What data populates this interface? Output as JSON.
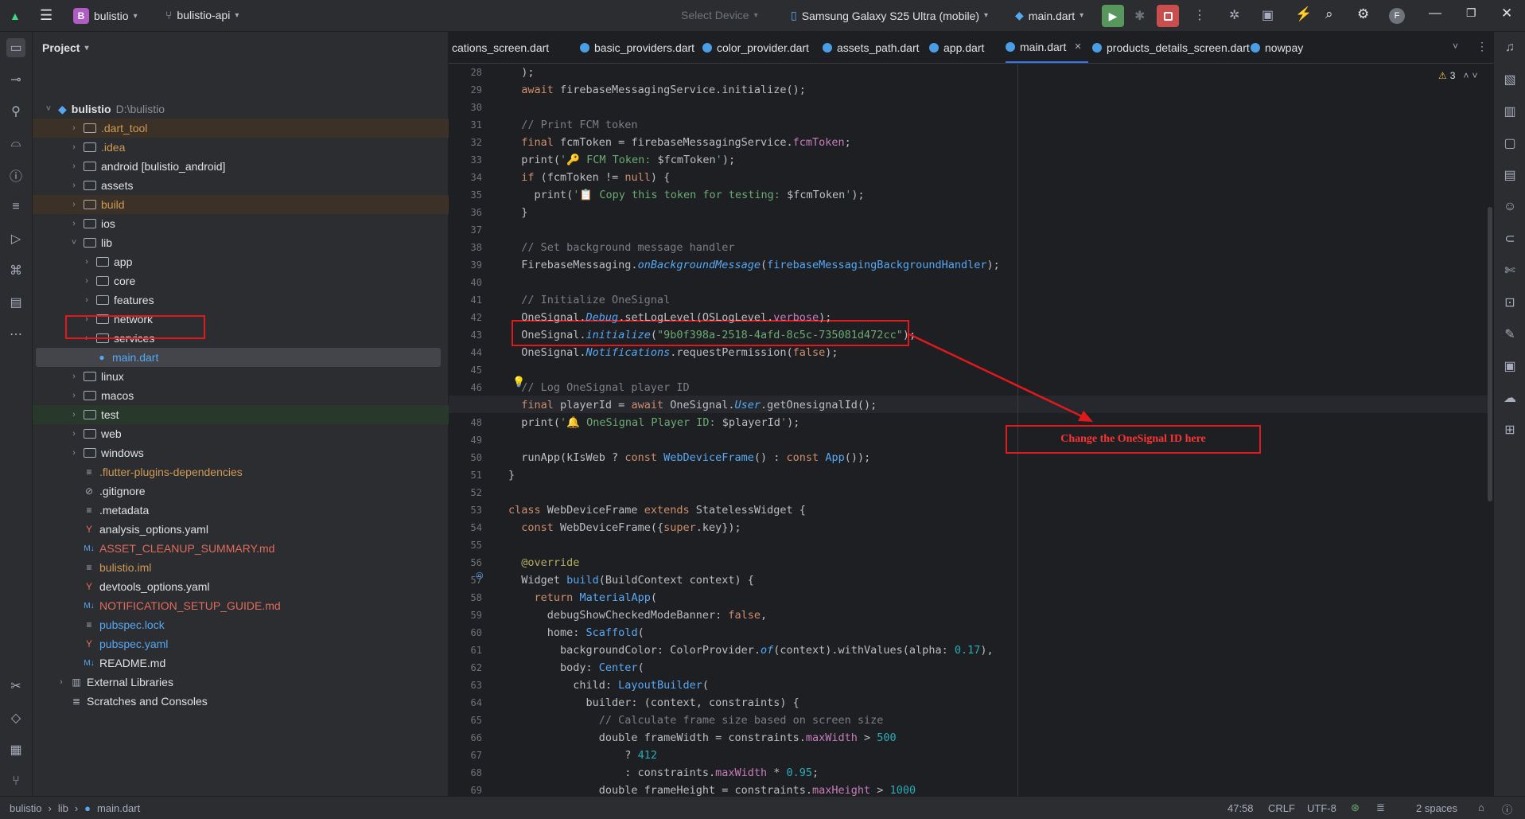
{
  "titlebar": {
    "project_badge": "B",
    "project_name": "bulistio",
    "branch": "bulistio-api",
    "select_device": "Select Device",
    "device": "Samsung Galaxy S25 Ultra (mobile)",
    "run_config": "main.dart",
    "avatar": "F"
  },
  "project_panel": {
    "title": "Project",
    "root_name": "bulistio",
    "root_path": "D:\\bulistio",
    "items": [
      {
        "label": ".dart_tool",
        "color": "#d09a55"
      },
      {
        "label": ".idea",
        "color": "#d09a55"
      },
      {
        "label": "android [bulistio_android]",
        "color": "#dfe1e5"
      },
      {
        "label": "assets",
        "color": "#dfe1e5"
      },
      {
        "label": "build",
        "color": "#d09a55"
      },
      {
        "label": "ios",
        "color": "#dfe1e5"
      },
      {
        "label": "lib",
        "color": "#dfe1e5"
      },
      {
        "label": "app",
        "color": "#dfe1e5"
      },
      {
        "label": "core",
        "color": "#dfe1e5"
      },
      {
        "label": "features",
        "color": "#dfe1e5"
      },
      {
        "label": "network",
        "color": "#dfe1e5"
      },
      {
        "label": "services",
        "color": "#dfe1e5"
      },
      {
        "label": "main.dart",
        "color": "#56a8f5"
      },
      {
        "label": "linux",
        "color": "#dfe1e5"
      },
      {
        "label": "macos",
        "color": "#dfe1e5"
      },
      {
        "label": "test",
        "color": "#dfe1e5"
      },
      {
        "label": "web",
        "color": "#dfe1e5"
      },
      {
        "label": "windows",
        "color": "#dfe1e5"
      },
      {
        "label": ".flutter-plugins-dependencies",
        "color": "#d09a55"
      },
      {
        "label": ".gitignore",
        "color": "#dfe1e5"
      },
      {
        "label": ".metadata",
        "color": "#dfe1e5"
      },
      {
        "label": "analysis_options.yaml",
        "color": "#dfe1e5"
      },
      {
        "label": "ASSET_CLEANUP_SUMMARY.md",
        "color": "#e06c5c"
      },
      {
        "label": "bulistio.iml",
        "color": "#d09a55"
      },
      {
        "label": "devtools_options.yaml",
        "color": "#dfe1e5"
      },
      {
        "label": "NOTIFICATION_SETUP_GUIDE.md",
        "color": "#e06c5c"
      },
      {
        "label": "pubspec.lock",
        "color": "#56a8f5"
      },
      {
        "label": "pubspec.yaml",
        "color": "#56a8f5"
      },
      {
        "label": "README.md",
        "color": "#dfe1e5"
      },
      {
        "label": "External Libraries",
        "color": "#dfe1e5"
      },
      {
        "label": "Scratches and Consoles",
        "color": "#dfe1e5"
      }
    ]
  },
  "tabs": [
    {
      "label": "cations_screen.dart"
    },
    {
      "label": "basic_providers.dart"
    },
    {
      "label": "color_provider.dart"
    },
    {
      "label": "assets_path.dart"
    },
    {
      "label": "app.dart"
    },
    {
      "label": "main.dart"
    },
    {
      "label": "products_details_screen.dart"
    },
    {
      "label": "nowpay"
    }
  ],
  "warnings": "3",
  "line_numbers": [
    "28",
    "29",
    "30",
    "31",
    "32",
    "33",
    "34",
    "35",
    "36",
    "37",
    "38",
    "39",
    "40",
    "41",
    "42",
    "43",
    "44",
    "45",
    "46",
    "47",
    "48",
    "49",
    "50",
    "51",
    "52",
    "53",
    "54",
    "55",
    "56",
    "57",
    "58",
    "59",
    "60",
    "61",
    "62",
    "63",
    "64",
    "65",
    "66",
    "67",
    "68",
    "69"
  ],
  "code": [
    [
      {
        "t": "  );",
        "c": ""
      }
    ],
    [
      {
        "t": "  ",
        "c": ""
      },
      {
        "t": "await",
        "c": "kw"
      },
      {
        "t": " firebaseMessagingService.initialize();",
        "c": ""
      }
    ],
    [],
    [
      {
        "t": "  // Print FCM token",
        "c": "cm"
      }
    ],
    [
      {
        "t": "  ",
        "c": ""
      },
      {
        "t": "final",
        "c": "kw"
      },
      {
        "t": " fcmToken = firebaseMessagingService.",
        "c": ""
      },
      {
        "t": "fcmToken",
        "c": "fld"
      },
      {
        "t": ";",
        "c": ""
      }
    ],
    [
      {
        "t": "  print(",
        "c": ""
      },
      {
        "t": "'🔑 FCM Token: ",
        "c": "str"
      },
      {
        "t": "$fcmToken",
        "c": ""
      },
      {
        "t": "'",
        "c": "str"
      },
      {
        "t": ");",
        "c": ""
      }
    ],
    [
      {
        "t": "  ",
        "c": ""
      },
      {
        "t": "if",
        "c": "kw"
      },
      {
        "t": " (fcmToken != ",
        "c": ""
      },
      {
        "t": "null",
        "c": "kw"
      },
      {
        "t": ") {",
        "c": ""
      }
    ],
    [
      {
        "t": "    print(",
        "c": ""
      },
      {
        "t": "'📋 Copy this token for testing: ",
        "c": "str"
      },
      {
        "t": "$fcmToken",
        "c": ""
      },
      {
        "t": "'",
        "c": "str"
      },
      {
        "t": ");",
        "c": ""
      }
    ],
    [
      {
        "t": "  }",
        "c": ""
      }
    ],
    [],
    [
      {
        "t": "  // Set background message handler",
        "c": "cm"
      }
    ],
    [
      {
        "t": "  FirebaseMessaging.",
        "c": ""
      },
      {
        "t": "onBackgroundMessage",
        "c": "it"
      },
      {
        "t": "(",
        "c": ""
      },
      {
        "t": "firebaseMessagingBackgroundHandler",
        "c": "fn"
      },
      {
        "t": ");",
        "c": ""
      }
    ],
    [],
    [
      {
        "t": "  // Initialize OneSignal",
        "c": "cm"
      }
    ],
    [
      {
        "t": "  OneSignal.",
        "c": ""
      },
      {
        "t": "Debug",
        "c": "it"
      },
      {
        "t": ".setLogLevel(OSLogLevel.",
        "c": ""
      },
      {
        "t": "verbose",
        "c": "fld"
      },
      {
        "t": ");",
        "c": ""
      }
    ],
    [
      {
        "t": "  OneSignal.",
        "c": ""
      },
      {
        "t": "initialize",
        "c": "it"
      },
      {
        "t": "(",
        "c": ""
      },
      {
        "t": "\"9b0f398a-2518-4afd-8c5c-735081d472cc\"",
        "c": "str"
      },
      {
        "t": ");",
        "c": ""
      }
    ],
    [
      {
        "t": "  OneSignal.",
        "c": ""
      },
      {
        "t": "Notifications",
        "c": "it"
      },
      {
        "t": ".requestPermission(",
        "c": ""
      },
      {
        "t": "false",
        "c": "kw"
      },
      {
        "t": ");",
        "c": ""
      }
    ],
    [],
    [
      {
        "t": "  // Log OneSignal player ID",
        "c": "cm"
      }
    ],
    [
      {
        "t": "  ",
        "c": ""
      },
      {
        "t": "final",
        "c": "kw"
      },
      {
        "t": " playerId = ",
        "c": ""
      },
      {
        "t": "await",
        "c": "kw"
      },
      {
        "t": " OneSignal.",
        "c": ""
      },
      {
        "t": "User",
        "c": "it"
      },
      {
        "t": ".getOnesignalId();",
        "c": ""
      }
    ],
    [
      {
        "t": "  print(",
        "c": ""
      },
      {
        "t": "'🔔 OneSignal Player ID: ",
        "c": "str"
      },
      {
        "t": "$playerId",
        "c": ""
      },
      {
        "t": "'",
        "c": "str"
      },
      {
        "t": ");",
        "c": ""
      }
    ],
    [],
    [
      {
        "t": "  runApp(kIsWeb ? ",
        "c": ""
      },
      {
        "t": "const",
        "c": "kw"
      },
      {
        "t": " ",
        "c": ""
      },
      {
        "t": "WebDeviceFrame",
        "c": "cls"
      },
      {
        "t": "() : ",
        "c": ""
      },
      {
        "t": "const",
        "c": "kw"
      },
      {
        "t": " ",
        "c": ""
      },
      {
        "t": "App",
        "c": "cls"
      },
      {
        "t": "());",
        "c": ""
      }
    ],
    [
      {
        "t": "}",
        "c": ""
      }
    ],
    [],
    [
      {
        "t": "class",
        "c": "kw"
      },
      {
        "t": " WebDeviceFrame ",
        "c": ""
      },
      {
        "t": "extends",
        "c": "kw"
      },
      {
        "t": " StatelessWidget {",
        "c": ""
      }
    ],
    [
      {
        "t": "  ",
        "c": ""
      },
      {
        "t": "const",
        "c": "kw"
      },
      {
        "t": " WebDeviceFrame({",
        "c": ""
      },
      {
        "t": "super",
        "c": "kw"
      },
      {
        "t": ".key});",
        "c": ""
      }
    ],
    [],
    [
      {
        "t": "  @override",
        "c": "an"
      }
    ],
    [
      {
        "t": "  Widget ",
        "c": ""
      },
      {
        "t": "build",
        "c": "fn"
      },
      {
        "t": "(BuildContext context) {",
        "c": ""
      }
    ],
    [
      {
        "t": "    ",
        "c": ""
      },
      {
        "t": "return",
        "c": "kw"
      },
      {
        "t": " ",
        "c": ""
      },
      {
        "t": "MaterialApp",
        "c": "cls"
      },
      {
        "t": "(",
        "c": ""
      }
    ],
    [
      {
        "t": "      debugShowCheckedModeBanner: ",
        "c": ""
      },
      {
        "t": "false",
        "c": "kw"
      },
      {
        "t": ",",
        "c": ""
      }
    ],
    [
      {
        "t": "      home: ",
        "c": ""
      },
      {
        "t": "Scaffold",
        "c": "cls"
      },
      {
        "t": "(",
        "c": ""
      }
    ],
    [
      {
        "t": "        backgroundColor: ColorProvider.",
        "c": ""
      },
      {
        "t": "of",
        "c": "it"
      },
      {
        "t": "(context).withValues(alpha: ",
        "c": ""
      },
      {
        "t": "0.17",
        "c": "num"
      },
      {
        "t": "),",
        "c": ""
      }
    ],
    [
      {
        "t": "        body: ",
        "c": ""
      },
      {
        "t": "Center",
        "c": "cls"
      },
      {
        "t": "(",
        "c": ""
      }
    ],
    [
      {
        "t": "          child: ",
        "c": ""
      },
      {
        "t": "LayoutBuilder",
        "c": "cls"
      },
      {
        "t": "(",
        "c": ""
      }
    ],
    [
      {
        "t": "            builder: (context, constraints) {",
        "c": ""
      }
    ],
    [
      {
        "t": "              // Calculate frame size based on screen size",
        "c": "cm"
      }
    ],
    [
      {
        "t": "              double frameWidth = constraints.",
        "c": ""
      },
      {
        "t": "maxWidth",
        "c": "fld"
      },
      {
        "t": " > ",
        "c": ""
      },
      {
        "t": "500",
        "c": "num"
      }
    ],
    [
      {
        "t": "                  ? ",
        "c": ""
      },
      {
        "t": "412",
        "c": "num"
      }
    ],
    [
      {
        "t": "                  : constraints.",
        "c": ""
      },
      {
        "t": "maxWidth",
        "c": "fld"
      },
      {
        "t": " * ",
        "c": ""
      },
      {
        "t": "0.95",
        "c": "num"
      },
      {
        "t": ";",
        "c": ""
      }
    ],
    [
      {
        "t": "              double frameHeight = constraints.",
        "c": ""
      },
      {
        "t": "maxHeight",
        "c": "fld"
      },
      {
        "t": " > ",
        "c": ""
      },
      {
        "t": "1000",
        "c": "num"
      }
    ]
  ],
  "annotation": "Change the OneSignal ID here",
  "statusbar": {
    "crumb_root": "bulistio",
    "crumb_dir": "lib",
    "crumb_file": "main.dart",
    "position": "47:58",
    "line_sep": "CRLF",
    "encoding": "UTF-8",
    "indent": "2 spaces"
  },
  "colors": {
    "annotation_red": "#e0191c",
    "run_green": "#57965c",
    "stop_red": "#c94f4f"
  }
}
